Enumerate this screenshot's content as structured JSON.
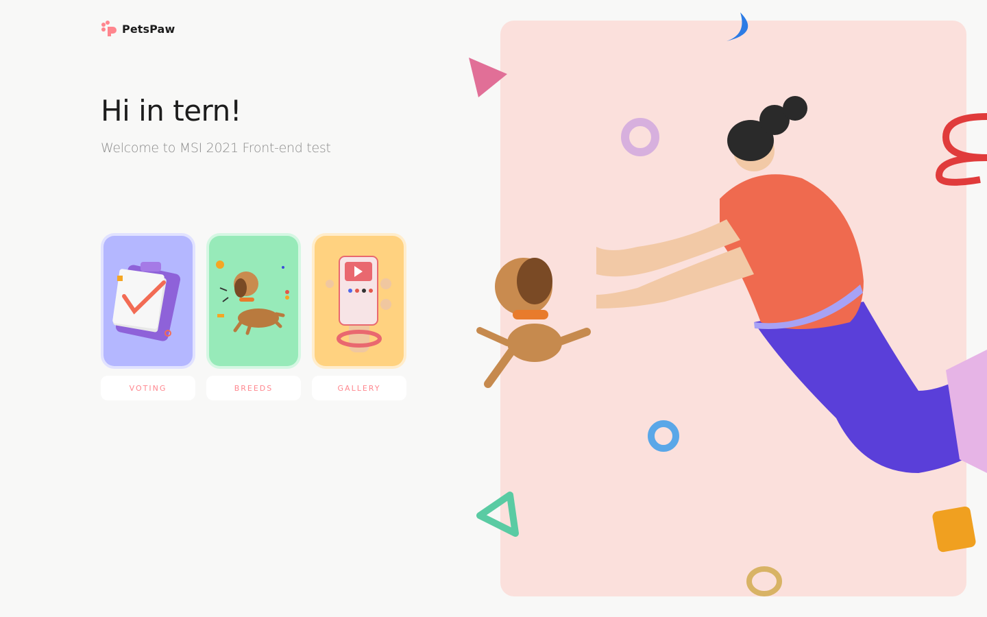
{
  "logo": {
    "text": "PetsPaw",
    "icon": "paw-icon"
  },
  "greeting": {
    "title": "Hi in tern!",
    "subtitle": "Welcome to MSI 2021 Front-end test"
  },
  "nav": [
    {
      "label": "VOTING",
      "icon": "clipboard-check-icon",
      "color": "#B4B7FF"
    },
    {
      "label": "BREEDS",
      "icon": "dog-icon",
      "color": "#97EAB9"
    },
    {
      "label": "GALLERY",
      "icon": "phone-gallery-icon",
      "color": "#FFD280"
    }
  ],
  "colors": {
    "accent": "#FF868E",
    "hero_bg": "#FBE0DC",
    "page_bg": "#F8F8F7"
  }
}
